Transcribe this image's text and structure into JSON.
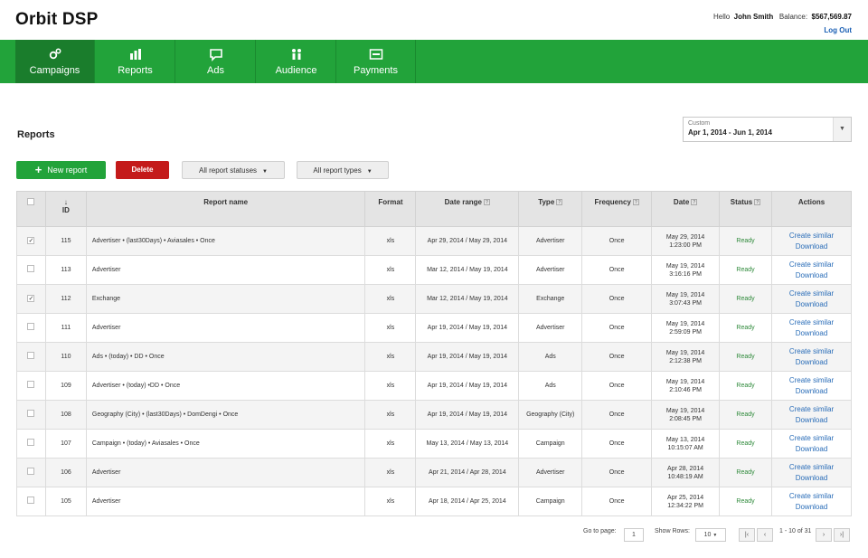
{
  "app": {
    "title": "Orbit DSP"
  },
  "user": {
    "greeting": "Hello",
    "name": "John Smith",
    "balance_label": "Balance:",
    "balance": "$567,569.87",
    "logout": "Log Out"
  },
  "nav": [
    {
      "label": "Campaigns",
      "icon": "gears-icon",
      "active": true
    },
    {
      "label": "Reports",
      "icon": "bar-chart-icon"
    },
    {
      "label": "Ads",
      "icon": "speech-bubble-icon"
    },
    {
      "label": "Audience",
      "icon": "people-icon"
    },
    {
      "label": "Payments",
      "icon": "card-icon"
    }
  ],
  "page": {
    "title": "Reports"
  },
  "daterange": {
    "label": "Custom",
    "value": "Apr 1, 2014 - Jun 1, 2014"
  },
  "toolbar": {
    "new_report": "New report",
    "delete": "Delete",
    "status_filter": "All report statuses",
    "type_filter": "All report types"
  },
  "table": {
    "headers": {
      "id": "ID",
      "name": "Report name",
      "format": "Format",
      "range": "Date range",
      "type": "Type",
      "frequency": "Frequency",
      "date": "Date",
      "status": "Status",
      "actions": "Actions"
    },
    "action_create": "Create similar",
    "action_download": "Download",
    "rows": [
      {
        "checked": true,
        "id": "115",
        "name": "Advertiser • (last30Days) • Aviasales • Once",
        "format": "xls",
        "range": "Apr 29, 2014 / May 29, 2014",
        "type": "Advertiser",
        "frequency": "Once",
        "date": "May 29, 2014",
        "time": "1:23:00 PM",
        "status": "Ready"
      },
      {
        "checked": false,
        "id": "113",
        "name": "Advertiser",
        "format": "xls",
        "range": "Mar 12, 2014 / May 19, 2014",
        "type": "Advertiser",
        "frequency": "Once",
        "date": "May 19, 2014",
        "time": "3:16:16 PM",
        "status": "Ready"
      },
      {
        "checked": true,
        "id": "112",
        "name": "Exchange",
        "format": "xls",
        "range": "Mar 12, 2014 / May 19, 2014",
        "type": "Exchange",
        "frequency": "Once",
        "date": "May 19, 2014",
        "time": "3:07:43 PM",
        "status": "Ready"
      },
      {
        "checked": false,
        "id": "111",
        "name": "Advertiser",
        "format": "xls",
        "range": "Apr 19, 2014 / May 19, 2014",
        "type": "Advertiser",
        "frequency": "Once",
        "date": "May 19, 2014",
        "time": "2:59:09 PM",
        "status": "Ready"
      },
      {
        "checked": false,
        "id": "110",
        "name": "Ads • (today) • DD • Once",
        "format": "xls",
        "range": "Apr 19, 2014 / May 19, 2014",
        "type": "Ads",
        "frequency": "Once",
        "date": "May 19, 2014",
        "time": "2:12:38 PM",
        "status": "Ready"
      },
      {
        "checked": false,
        "id": "109",
        "name": "Advertiser • (today) •DD • Once",
        "format": "xls",
        "range": "Apr 19, 2014 / May 19, 2014",
        "type": "Ads",
        "frequency": "Once",
        "date": "May 19, 2014",
        "time": "2:10:46 PM",
        "status": "Ready"
      },
      {
        "checked": false,
        "id": "108",
        "name": "Geography (City) • (last30Days) • DomDengi • Once",
        "format": "xls",
        "range": "Apr 19, 2014 / May 19, 2014",
        "type": "Geography (City)",
        "frequency": "Once",
        "date": "May 19, 2014",
        "time": "2:08:45 PM",
        "status": "Ready"
      },
      {
        "checked": false,
        "id": "107",
        "name": "Campaign • (today) • Aviasales • Once",
        "format": "xls",
        "range": "May 13, 2014 / May 13, 2014",
        "type": "Campaign",
        "frequency": "Once",
        "date": "May 13, 2014",
        "time": "10:15:07 AM",
        "status": "Ready"
      },
      {
        "checked": false,
        "id": "106",
        "name": "Advertiser",
        "format": "xls",
        "range": "Apr 21, 2014 / Apr 28, 2014",
        "type": "Advertiser",
        "frequency": "Once",
        "date": "Apr 28, 2014",
        "time": "10:48:19 AM",
        "status": "Ready"
      },
      {
        "checked": false,
        "id": "105",
        "name": "Advertiser",
        "format": "xls",
        "range": "Apr 18, 2014 / Apr 25, 2014",
        "type": "Campaign",
        "frequency": "Once",
        "date": "Apr 25, 2014",
        "time": "12:34:22 PM",
        "status": "Ready"
      }
    ]
  },
  "pagination": {
    "goto_label": "Go to page:",
    "goto_value": "1",
    "rows_label": "Show Rows:",
    "rows_value": "10",
    "range_text": "1 - 10 of 31"
  }
}
